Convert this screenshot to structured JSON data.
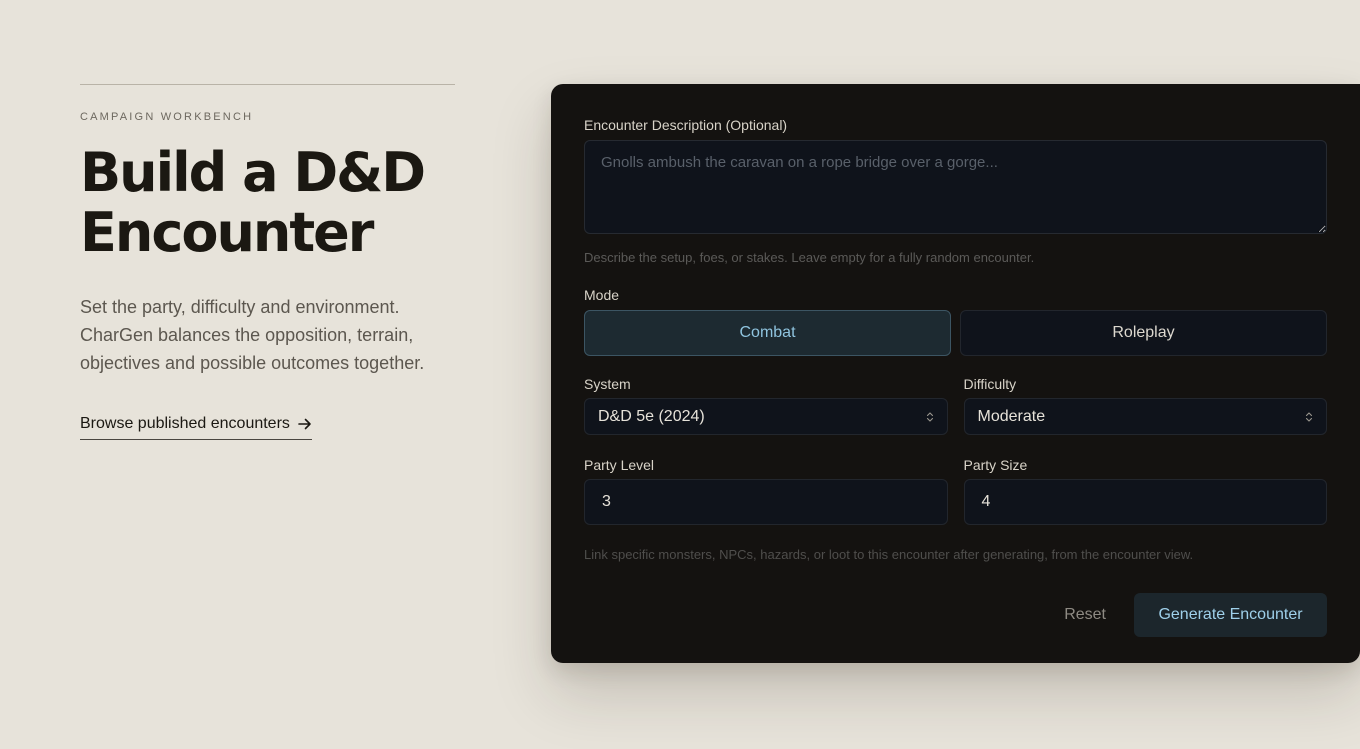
{
  "hero": {
    "eyebrow": "CAMPAIGN WORKBENCH",
    "title_line1": "Build a D&D",
    "title_line2": "Encounter",
    "intro": "Set the party, difficulty and environment. CharGen balances the opposition, terrain, objectives and possible outcomes together.",
    "browse_link": "Browse published encounters"
  },
  "form": {
    "description": {
      "label": "Encounter Description (Optional)",
      "value": "",
      "placeholder": "Gnolls ambush the caravan on a rope bridge over a gorge...",
      "hint": "Describe the setup, foes, or stakes. Leave empty for a fully random encounter."
    },
    "mode": {
      "label": "Mode",
      "options": [
        "Combat",
        "Roleplay"
      ],
      "selected": "Combat"
    },
    "system": {
      "label": "System",
      "value": "D&D 5e (2024)"
    },
    "difficulty": {
      "label": "Difficulty",
      "value": "Moderate"
    },
    "party_level": {
      "label": "Party Level",
      "value": "3"
    },
    "party_size": {
      "label": "Party Size",
      "value": "4"
    },
    "link_hint": "Link specific monsters, NPCs, hazards, or loot to this encounter after generating, from the encounter view.",
    "reset_label": "Reset",
    "generate_label": "Generate Encounter"
  },
  "icons": {
    "browse_arrow": "arrow-right-icon",
    "select_chevron": "chevron-up-down-icon"
  },
  "colors": {
    "page_bg": "#e7e3da",
    "card_bg": "#141210",
    "accent": "#8fc4df"
  }
}
